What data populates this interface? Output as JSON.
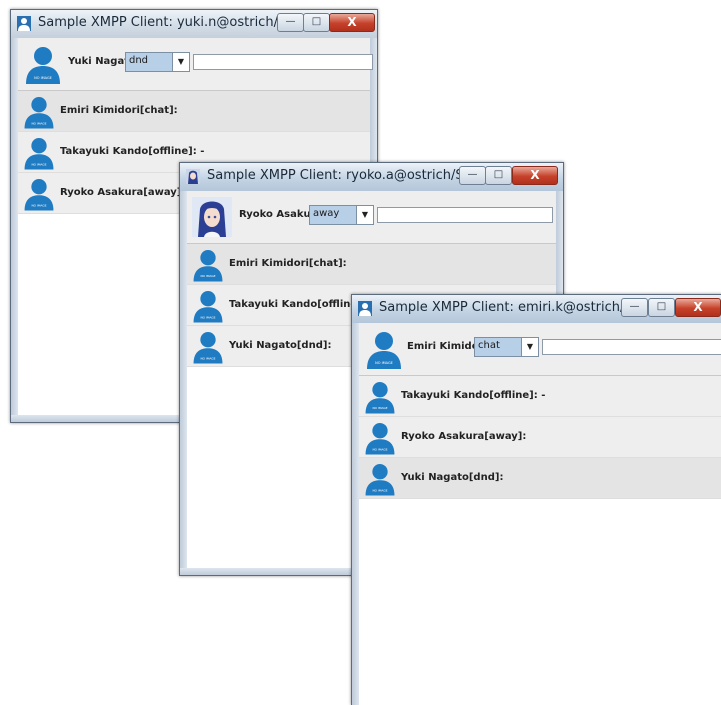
{
  "windows": [
    {
      "title": "Sample XMPP Client: yuki.n@ostrich/...",
      "user": "Yuki Nagato",
      "status": "dnd",
      "message": "",
      "contacts": [
        {
          "label": "Emiri Kimidori[chat]:"
        },
        {
          "label": "Takayuki Kando[offline]: -"
        },
        {
          "label": "Ryoko Asakura[away]:"
        }
      ]
    },
    {
      "title": "Sample XMPP Client: ryoko.a@ostrich/S...",
      "user": "Ryoko Asakura",
      "status": "away",
      "message": "",
      "contacts": [
        {
          "label": "Emiri Kimidori[chat]:"
        },
        {
          "label": "Takayuki Kando[offline]: -"
        },
        {
          "label": "Yuki Nagato[dnd]:"
        }
      ]
    },
    {
      "title": "Sample XMPP Client: emiri.k@ostrich/...",
      "user": "Emiri Kimidori",
      "status": "chat",
      "message": "",
      "contacts": [
        {
          "label": "Takayuki Kando[offline]: -"
        },
        {
          "label": "Ryoko Asakura[away]:"
        },
        {
          "label": "Yuki Nagato[dnd]:"
        }
      ]
    }
  ],
  "window_controls": {
    "minimize": "—",
    "maximize": "□",
    "close": "X"
  },
  "avatar_caption": "NO IMAGE",
  "colors": {
    "avatar": "#1f7bc2",
    "status_select": "#b8cfe8",
    "close_button": "#c5412a"
  },
  "icons": [
    "user-icon",
    "anime-character-avatar",
    "chevron-down-icon"
  ]
}
